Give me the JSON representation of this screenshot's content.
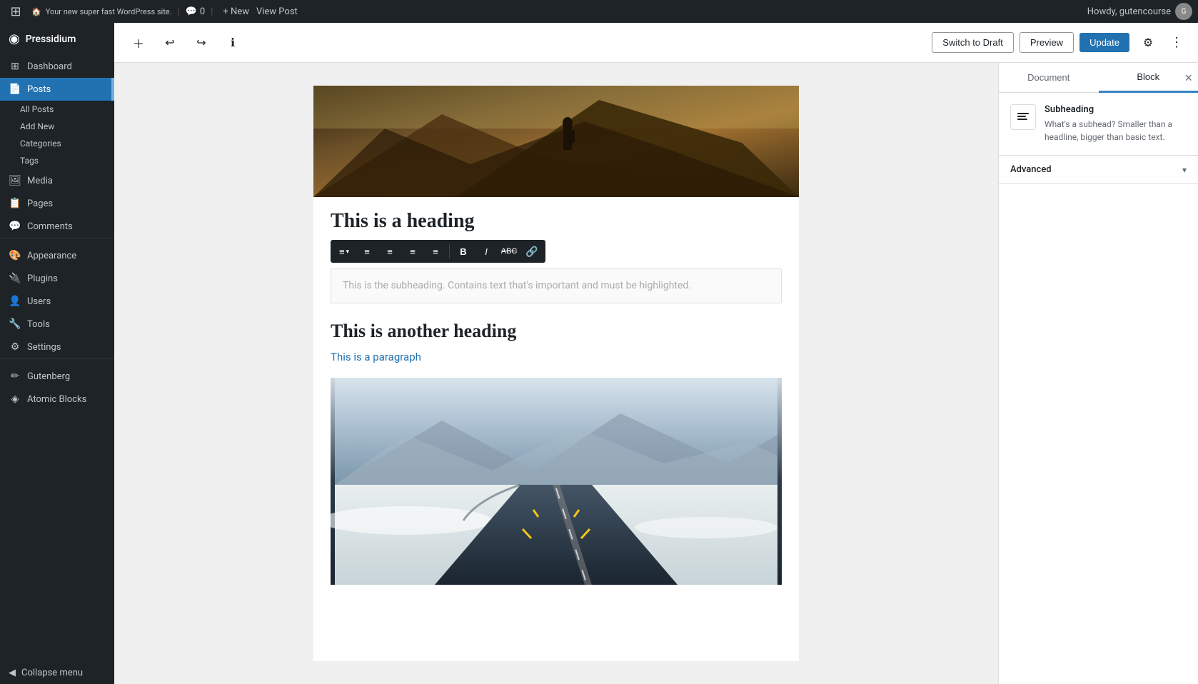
{
  "admin_bar": {
    "wp_logo": "⊞",
    "site_name": "Your new super fast WordPress site.",
    "comments_icon": "💬",
    "comments_count": "0",
    "new_label": "+ New",
    "view_post": "View Post",
    "howdy": "Howdy, gutencourse",
    "avatar_initials": "G"
  },
  "sidebar": {
    "brand_name": "Pressidium",
    "items": [
      {
        "id": "dashboard",
        "icon": "⊞",
        "label": "Dashboard"
      },
      {
        "id": "posts",
        "icon": "📄",
        "label": "Posts",
        "active": true
      },
      {
        "id": "media",
        "icon": "🖼",
        "label": "Media"
      },
      {
        "id": "pages",
        "icon": "📋",
        "label": "Pages"
      },
      {
        "id": "comments",
        "icon": "💬",
        "label": "Comments"
      },
      {
        "id": "appearance",
        "icon": "🎨",
        "label": "Appearance"
      },
      {
        "id": "plugins",
        "icon": "🔌",
        "label": "Plugins"
      },
      {
        "id": "users",
        "icon": "👤",
        "label": "Users"
      },
      {
        "id": "tools",
        "icon": "🔧",
        "label": "Tools"
      },
      {
        "id": "settings",
        "icon": "⚙",
        "label": "Settings"
      },
      {
        "id": "gutenberg",
        "icon": "✏",
        "label": "Gutenberg"
      },
      {
        "id": "atomic-blocks",
        "icon": "◈",
        "label": "Atomic Blocks"
      }
    ],
    "posts_sub": [
      {
        "label": "All Posts"
      },
      {
        "label": "Add New"
      },
      {
        "label": "Categories"
      },
      {
        "label": "Tags"
      }
    ],
    "collapse": "Collapse menu"
  },
  "toolbar": {
    "add_block_label": "+",
    "undo_label": "↩",
    "redo_label": "↪",
    "info_label": "ℹ",
    "switch_to_draft": "Switch to Draft",
    "preview": "Preview",
    "update": "Update",
    "settings_icon": "⚙",
    "more_icon": "⋮"
  },
  "format_toolbar": {
    "align_icon": "≡",
    "dropdown_arrow": "▾",
    "align_left": "≡",
    "align_center": "≡",
    "align_right": "≡",
    "align_justify": "≡",
    "bold": "B",
    "italic": "I",
    "strikethrough": "ABC",
    "link": "🔗"
  },
  "content": {
    "heading1": "This is a heading",
    "subheading_placeholder": "This is the subheading. Contains text that's important and must be highlighted.",
    "heading2": "This is another heading",
    "paragraph": "This is a paragraph"
  },
  "right_panel": {
    "tab_document": "Document",
    "tab_block": "Block",
    "close_icon": "×",
    "block_name": "Subheading",
    "block_description": "What's a subhead? Smaller than a headline, bigger than basic text.",
    "advanced_label": "Advanced",
    "chevron": "▾"
  }
}
